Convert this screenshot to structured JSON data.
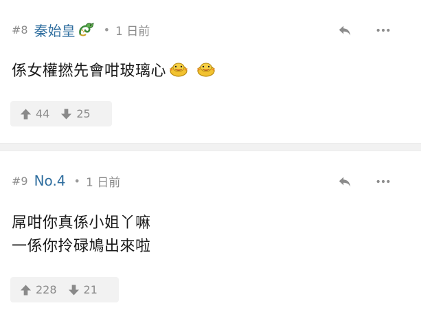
{
  "posts": [
    {
      "floor": "#8",
      "username": "秦始皇",
      "time": "1 日前",
      "content_lines": [
        "係女權撚先會咁玻璃心"
      ],
      "upvotes": "44",
      "downvotes": "25",
      "username_color": "#2f6e9f",
      "badge_icon": "dragon-icon",
      "emoji_icons": [
        "duck-emoji-icon",
        "duck-emoji-icon"
      ]
    },
    {
      "floor": "#9",
      "username": "No.4",
      "time": "1 日前",
      "content_lines": [
        "屌咁你真係小姐丫嘛",
        "一係你拎碌鳩出來啦"
      ],
      "upvotes": "228",
      "downvotes": "21",
      "username_color": "#2f6e9f"
    }
  ],
  "icons": {
    "reply": "reply-icon",
    "more": "more-icon",
    "upvote": "thumb-up-arrow-icon",
    "downvote": "thumb-down-arrow-icon"
  }
}
